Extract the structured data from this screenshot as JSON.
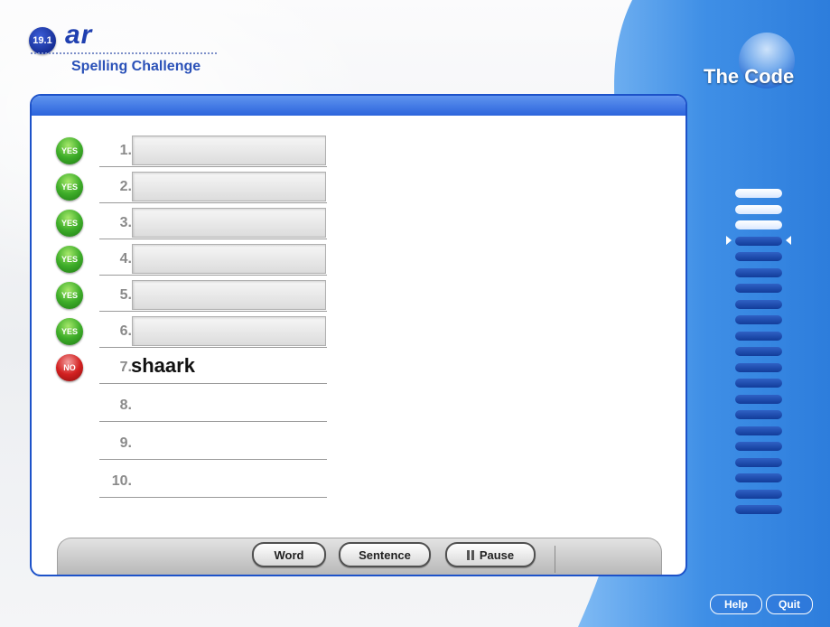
{
  "header": {
    "lesson_badge": "19.1",
    "sound": "ar",
    "subtitle": "Spelling Challenge"
  },
  "side_panel": {
    "title": "The Code",
    "meter_total": 21,
    "meter_lit": 3,
    "meter_current": 4
  },
  "rows": [
    {
      "num": "1.",
      "status": "YES",
      "answer": ""
    },
    {
      "num": "2.",
      "status": "YES",
      "answer": ""
    },
    {
      "num": "3.",
      "status": "YES",
      "answer": ""
    },
    {
      "num": "4.",
      "status": "YES",
      "answer": ""
    },
    {
      "num": "5.",
      "status": "YES",
      "answer": ""
    },
    {
      "num": "6.",
      "status": "YES",
      "answer": ""
    },
    {
      "num": "7.",
      "status": "NO",
      "answer": "shaark"
    },
    {
      "num": "8.",
      "status": "",
      "answer": ""
    },
    {
      "num": "9.",
      "status": "",
      "answer": ""
    },
    {
      "num": "10.",
      "status": "",
      "answer": ""
    }
  ],
  "controls": {
    "word": "Word",
    "sentence": "Sentence",
    "pause": "Pause"
  },
  "footer": {
    "help": "Help",
    "quit": "Quit"
  },
  "colors": {
    "accent_blue": "#1d52c9",
    "panel_blue": "#3a8ee6",
    "yes_green": "#3fae2a",
    "no_red": "#d32121"
  }
}
